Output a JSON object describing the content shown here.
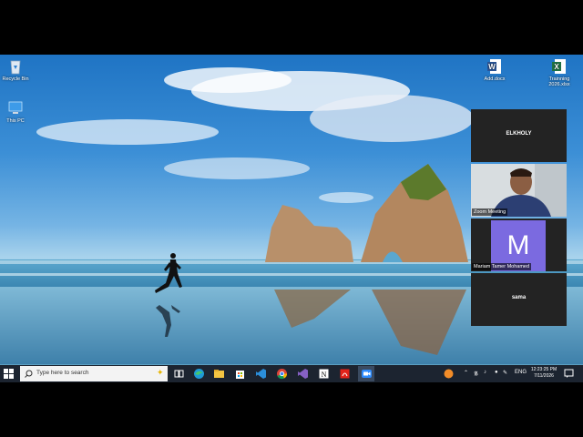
{
  "desktop": {
    "icons": [
      {
        "label": "Recycle Bin",
        "icon": "recycle-bin-icon"
      },
      {
        "label": "This PC",
        "icon": "computer-icon"
      },
      {
        "label": "Add.docx",
        "icon": "word-doc-icon"
      },
      {
        "label": "Trainning 2026.xlsx",
        "icon": "excel-doc-icon"
      }
    ]
  },
  "zoom": {
    "participants": [
      {
        "name": "ELKHOLY",
        "type": "name-only"
      },
      {
        "caption": "Zoom Meeting",
        "type": "video"
      },
      {
        "initial": "M",
        "caption": "Mariam Tamer Mohamed",
        "type": "avatar"
      },
      {
        "name": "sama",
        "type": "name-only"
      }
    ]
  },
  "taskbar": {
    "search_placeholder": "Type here to search",
    "pinned": [
      "task-view-icon",
      "edge-icon",
      "file-explorer-icon",
      "store-icon",
      "vscode-icon",
      "chrome-icon",
      "visual-studio-icon",
      "notion-icon",
      "acrobat-icon",
      "zoom-icon"
    ],
    "tray": {
      "language": "ENG",
      "time": "12:23:25 PM",
      "date": "7/11/2026"
    }
  },
  "colors": {
    "taskbar": "#1c2430",
    "zoom_avatar": "#7b6ae0"
  }
}
